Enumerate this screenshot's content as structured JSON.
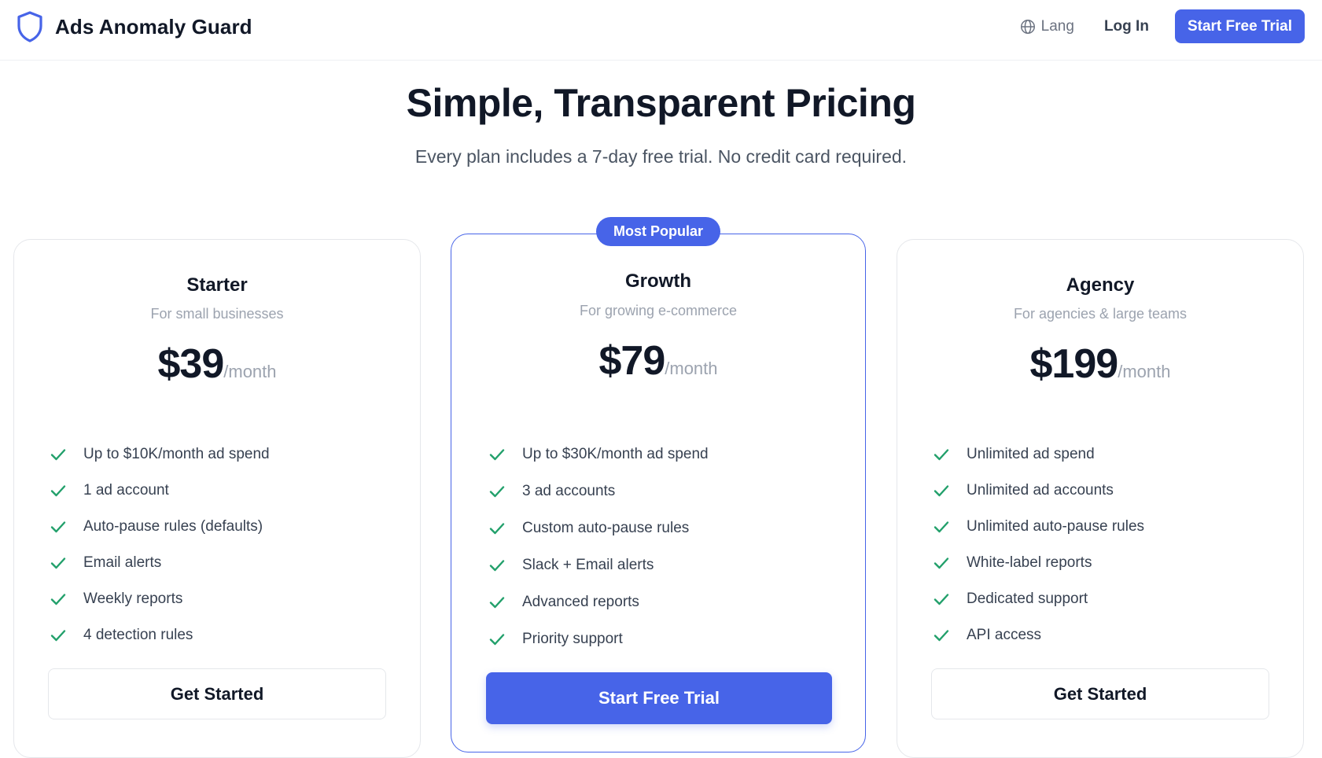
{
  "header": {
    "brand_name": "Ads Anomaly Guard",
    "brand_icon": "shield-icon",
    "lang_label": "Lang",
    "lang_icon": "globe-icon",
    "login_label": "Log In",
    "cta_label": "Start Free Trial"
  },
  "hero": {
    "title": "Simple, Transparent Pricing",
    "subtitle": "Every plan includes a 7-day free trial. No credit card required."
  },
  "plans": [
    {
      "name": "Starter",
      "description": "For small businesses",
      "price": "$39",
      "period": "/month",
      "featured": false,
      "features": [
        "Up to $10K/month ad spend",
        "1 ad account",
        "Auto-pause rules (defaults)",
        "Email alerts",
        "Weekly reports",
        "4 detection rules"
      ],
      "button_label": "Get Started"
    },
    {
      "name": "Growth",
      "description": "For growing e-commerce",
      "price": "$79",
      "period": "/month",
      "featured": true,
      "badge": "Most Popular",
      "features": [
        "Up to $30K/month ad spend",
        "3 ad accounts",
        "Custom auto-pause rules",
        "Slack + Email alerts",
        "Advanced reports",
        "Priority support"
      ],
      "button_label": "Start Free Trial"
    },
    {
      "name": "Agency",
      "description": "For agencies & large teams",
      "price": "$199",
      "period": "/month",
      "featured": false,
      "features": [
        "Unlimited ad spend",
        "Unlimited ad accounts",
        "Unlimited auto-pause rules",
        "White-label reports",
        "Dedicated support",
        "API access"
      ],
      "button_label": "Get Started"
    }
  ],
  "colors": {
    "accent": "#4764e8",
    "check": "#22a06b",
    "text_dark": "#111827",
    "text_muted": "#9ca3af"
  }
}
